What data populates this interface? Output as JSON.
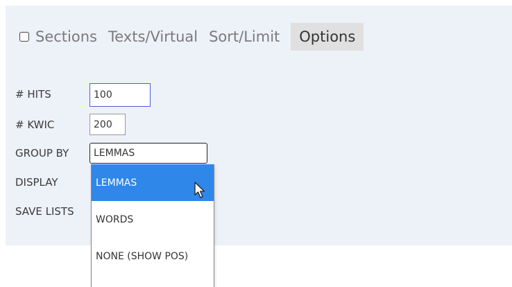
{
  "tabs": {
    "sections_label": "Sections",
    "texts_label": "Texts/Virtual",
    "sort_label": "Sort/Limit",
    "options_label": "Options"
  },
  "options_form": {
    "hits_label": "# HITS",
    "hits_value": "100",
    "kwic_label": "# KWIC",
    "kwic_value": "200",
    "group_by_label": "GROUP BY",
    "group_by_selected": "LEMMAS",
    "display_label": "DISPLAY",
    "save_lists_label": "SAVE LISTS"
  },
  "group_by_dropdown": {
    "options": [
      "LEMMAS",
      "WORDS",
      "NONE (SHOW POS)"
    ],
    "highlighted_index": 0
  },
  "colors": {
    "panel_background": "#edf1f8",
    "highlight": "#2f87ea",
    "active_tab_background": "#e0e0e0",
    "focused_input_border": "#4a5bd8"
  }
}
